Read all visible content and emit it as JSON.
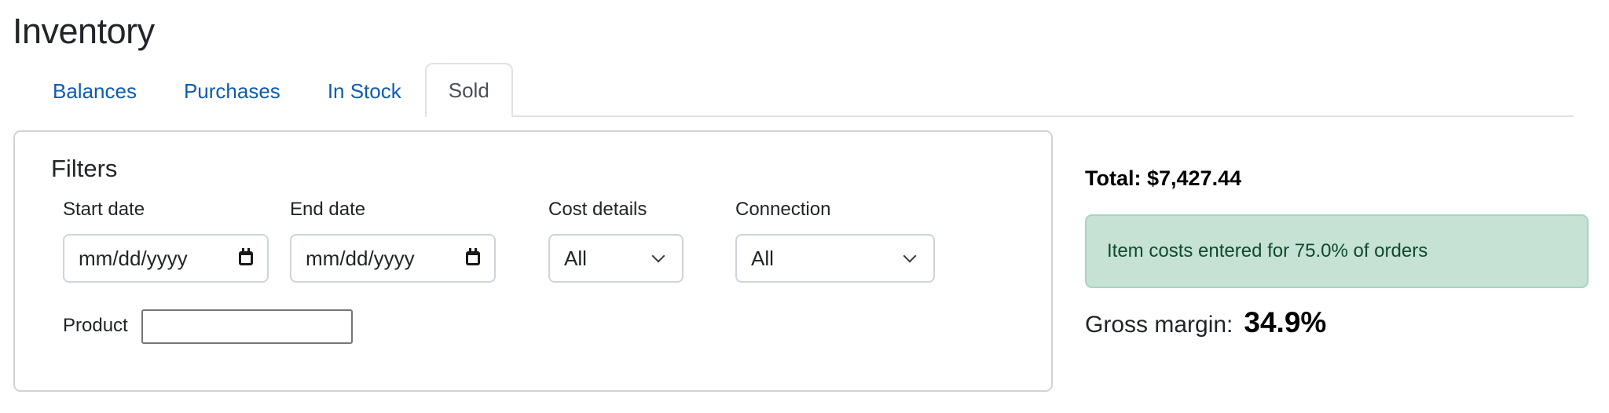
{
  "page": {
    "title": "Inventory"
  },
  "tabs": [
    {
      "label": "Balances",
      "active": false
    },
    {
      "label": "Purchases",
      "active": false
    },
    {
      "label": "In Stock",
      "active": false
    },
    {
      "label": "Sold",
      "active": true
    }
  ],
  "filters": {
    "title": "Filters",
    "start_date": {
      "label": "Start date",
      "placeholder": "mm/dd/yyyy",
      "value": "",
      "icon": "calendar-icon"
    },
    "end_date": {
      "label": "End date",
      "placeholder": "mm/dd/yyyy",
      "value": "",
      "icon": "calendar-icon"
    },
    "cost_details": {
      "label": "Cost details",
      "selected": "All",
      "icon": "chevron-down-icon"
    },
    "connection": {
      "label": "Connection",
      "selected": "All",
      "icon": "chevron-down-icon"
    },
    "product": {
      "label": "Product",
      "value": ""
    }
  },
  "summary": {
    "total": "Total: $7,427.44",
    "alert_text": "Item costs entered for 75.0% of orders",
    "gross_margin_label": "Gross margin:",
    "gross_margin_value": "34.9%"
  },
  "colors": {
    "link": "#0d5cb0",
    "alert_bg": "#c6e2d5",
    "alert_text": "#0f4a2c"
  }
}
